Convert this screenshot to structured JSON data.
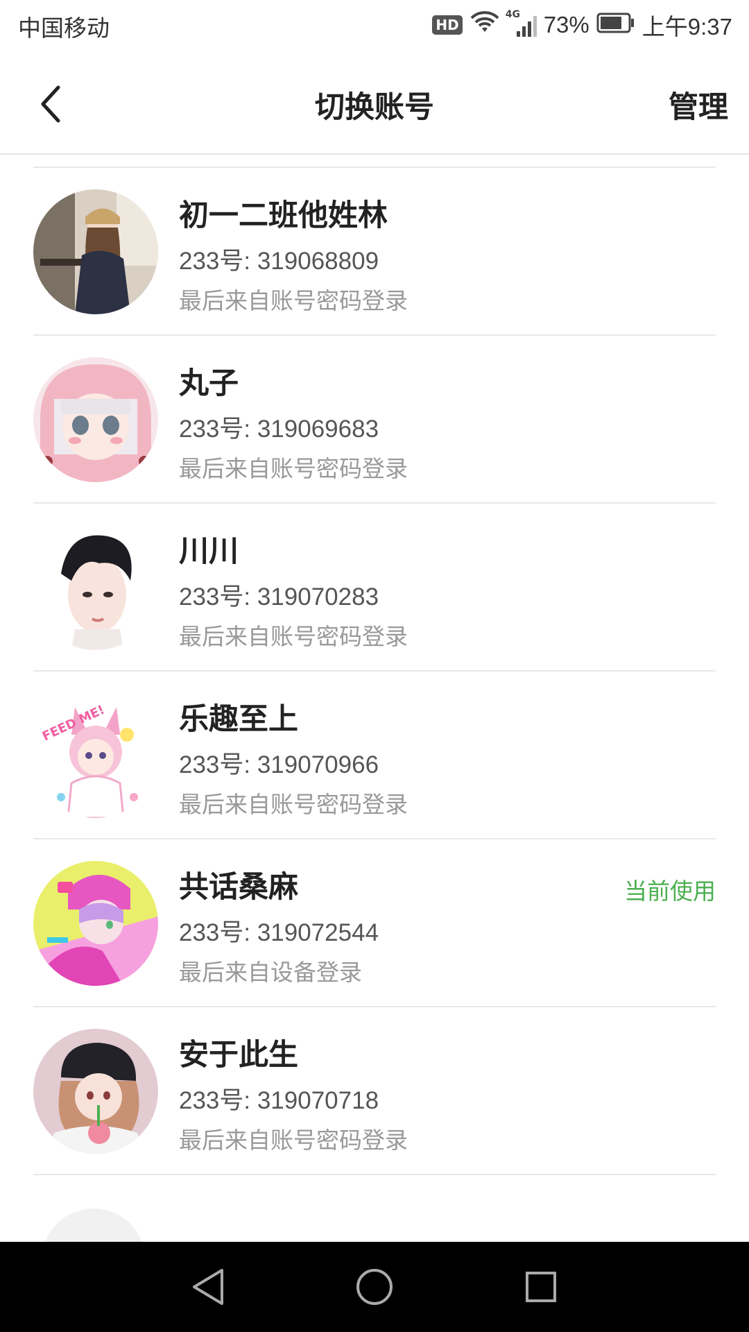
{
  "status_bar": {
    "carrier": "中国移动",
    "hd": "HD",
    "network": "4G",
    "battery": "73%",
    "time": "上午9:37"
  },
  "nav": {
    "title": "切换账号",
    "manage": "管理",
    "back_icon": "chevron-left-icon"
  },
  "accounts": [
    {
      "name": "初一二班他姓林",
      "id": "233号: 319068809",
      "login": "最后来自账号密码登录",
      "current": ""
    },
    {
      "name": "丸子",
      "id": "233号: 319069683",
      "login": "最后来自账号密码登录",
      "current": ""
    },
    {
      "name": "川川",
      "id": "233号: 319070283",
      "login": "最后来自账号密码登录",
      "current": ""
    },
    {
      "name": "乐趣至上",
      "id": "233号: 319070966",
      "login": "最后来自账号密码登录",
      "current": ""
    },
    {
      "name": "共话桑麻",
      "id": "233号: 319072544",
      "login": "最后来自设备登录",
      "current": "当前使用"
    },
    {
      "name": "安于此生",
      "id": "233号: 319070718",
      "login": "最后来自账号密码登录",
      "current": ""
    }
  ],
  "avatar_art": {
    "top_label": "FEED ME!"
  },
  "colors": {
    "current_tag": "#4caf50",
    "divider": "#e8e8e8",
    "sys_nav_bg": "#000000"
  },
  "system_nav": {
    "back_icon": "triangle-back-icon",
    "home_icon": "circle-home-icon",
    "recents_icon": "square-recents-icon"
  }
}
